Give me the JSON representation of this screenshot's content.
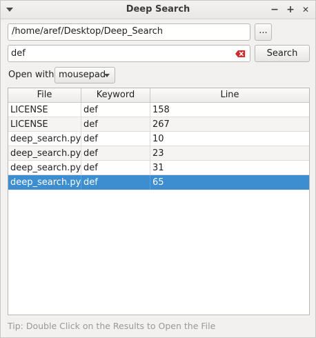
{
  "window": {
    "title": "Deep Search",
    "minimize_glyph": "−",
    "maximize_glyph": "+",
    "close_glyph": "✕"
  },
  "path_input": {
    "value": "/home/aref/Desktop/Deep_Search"
  },
  "browse_button": {
    "label": "..."
  },
  "search_input": {
    "value": "def"
  },
  "search_button": {
    "label": "Search"
  },
  "open_with": {
    "label": "Open with:",
    "selected": "mousepad"
  },
  "table": {
    "columns": [
      "File",
      "Keyword",
      "Line"
    ],
    "rows": [
      {
        "file": "LICENSE",
        "keyword": "def",
        "line": "158"
      },
      {
        "file": "LICENSE",
        "keyword": "def",
        "line": "267"
      },
      {
        "file": "deep_search.py",
        "keyword": "def",
        "line": "10"
      },
      {
        "file": "deep_search.py",
        "keyword": "def",
        "line": "23"
      },
      {
        "file": "deep_search.py",
        "keyword": "def",
        "line": "31"
      },
      {
        "file": "deep_search.py",
        "keyword": "def",
        "line": "65"
      }
    ],
    "selected_row": 5
  },
  "tip": "Tip: Double Click on the Results to Open the File",
  "icons": {
    "window_menu": "chevron-down-icon",
    "clear": "clear-text-icon",
    "combo_arrow": "chevron-down-icon"
  },
  "colors": {
    "selection": "#3d8ed1",
    "clear_icon": "#d9262c"
  }
}
